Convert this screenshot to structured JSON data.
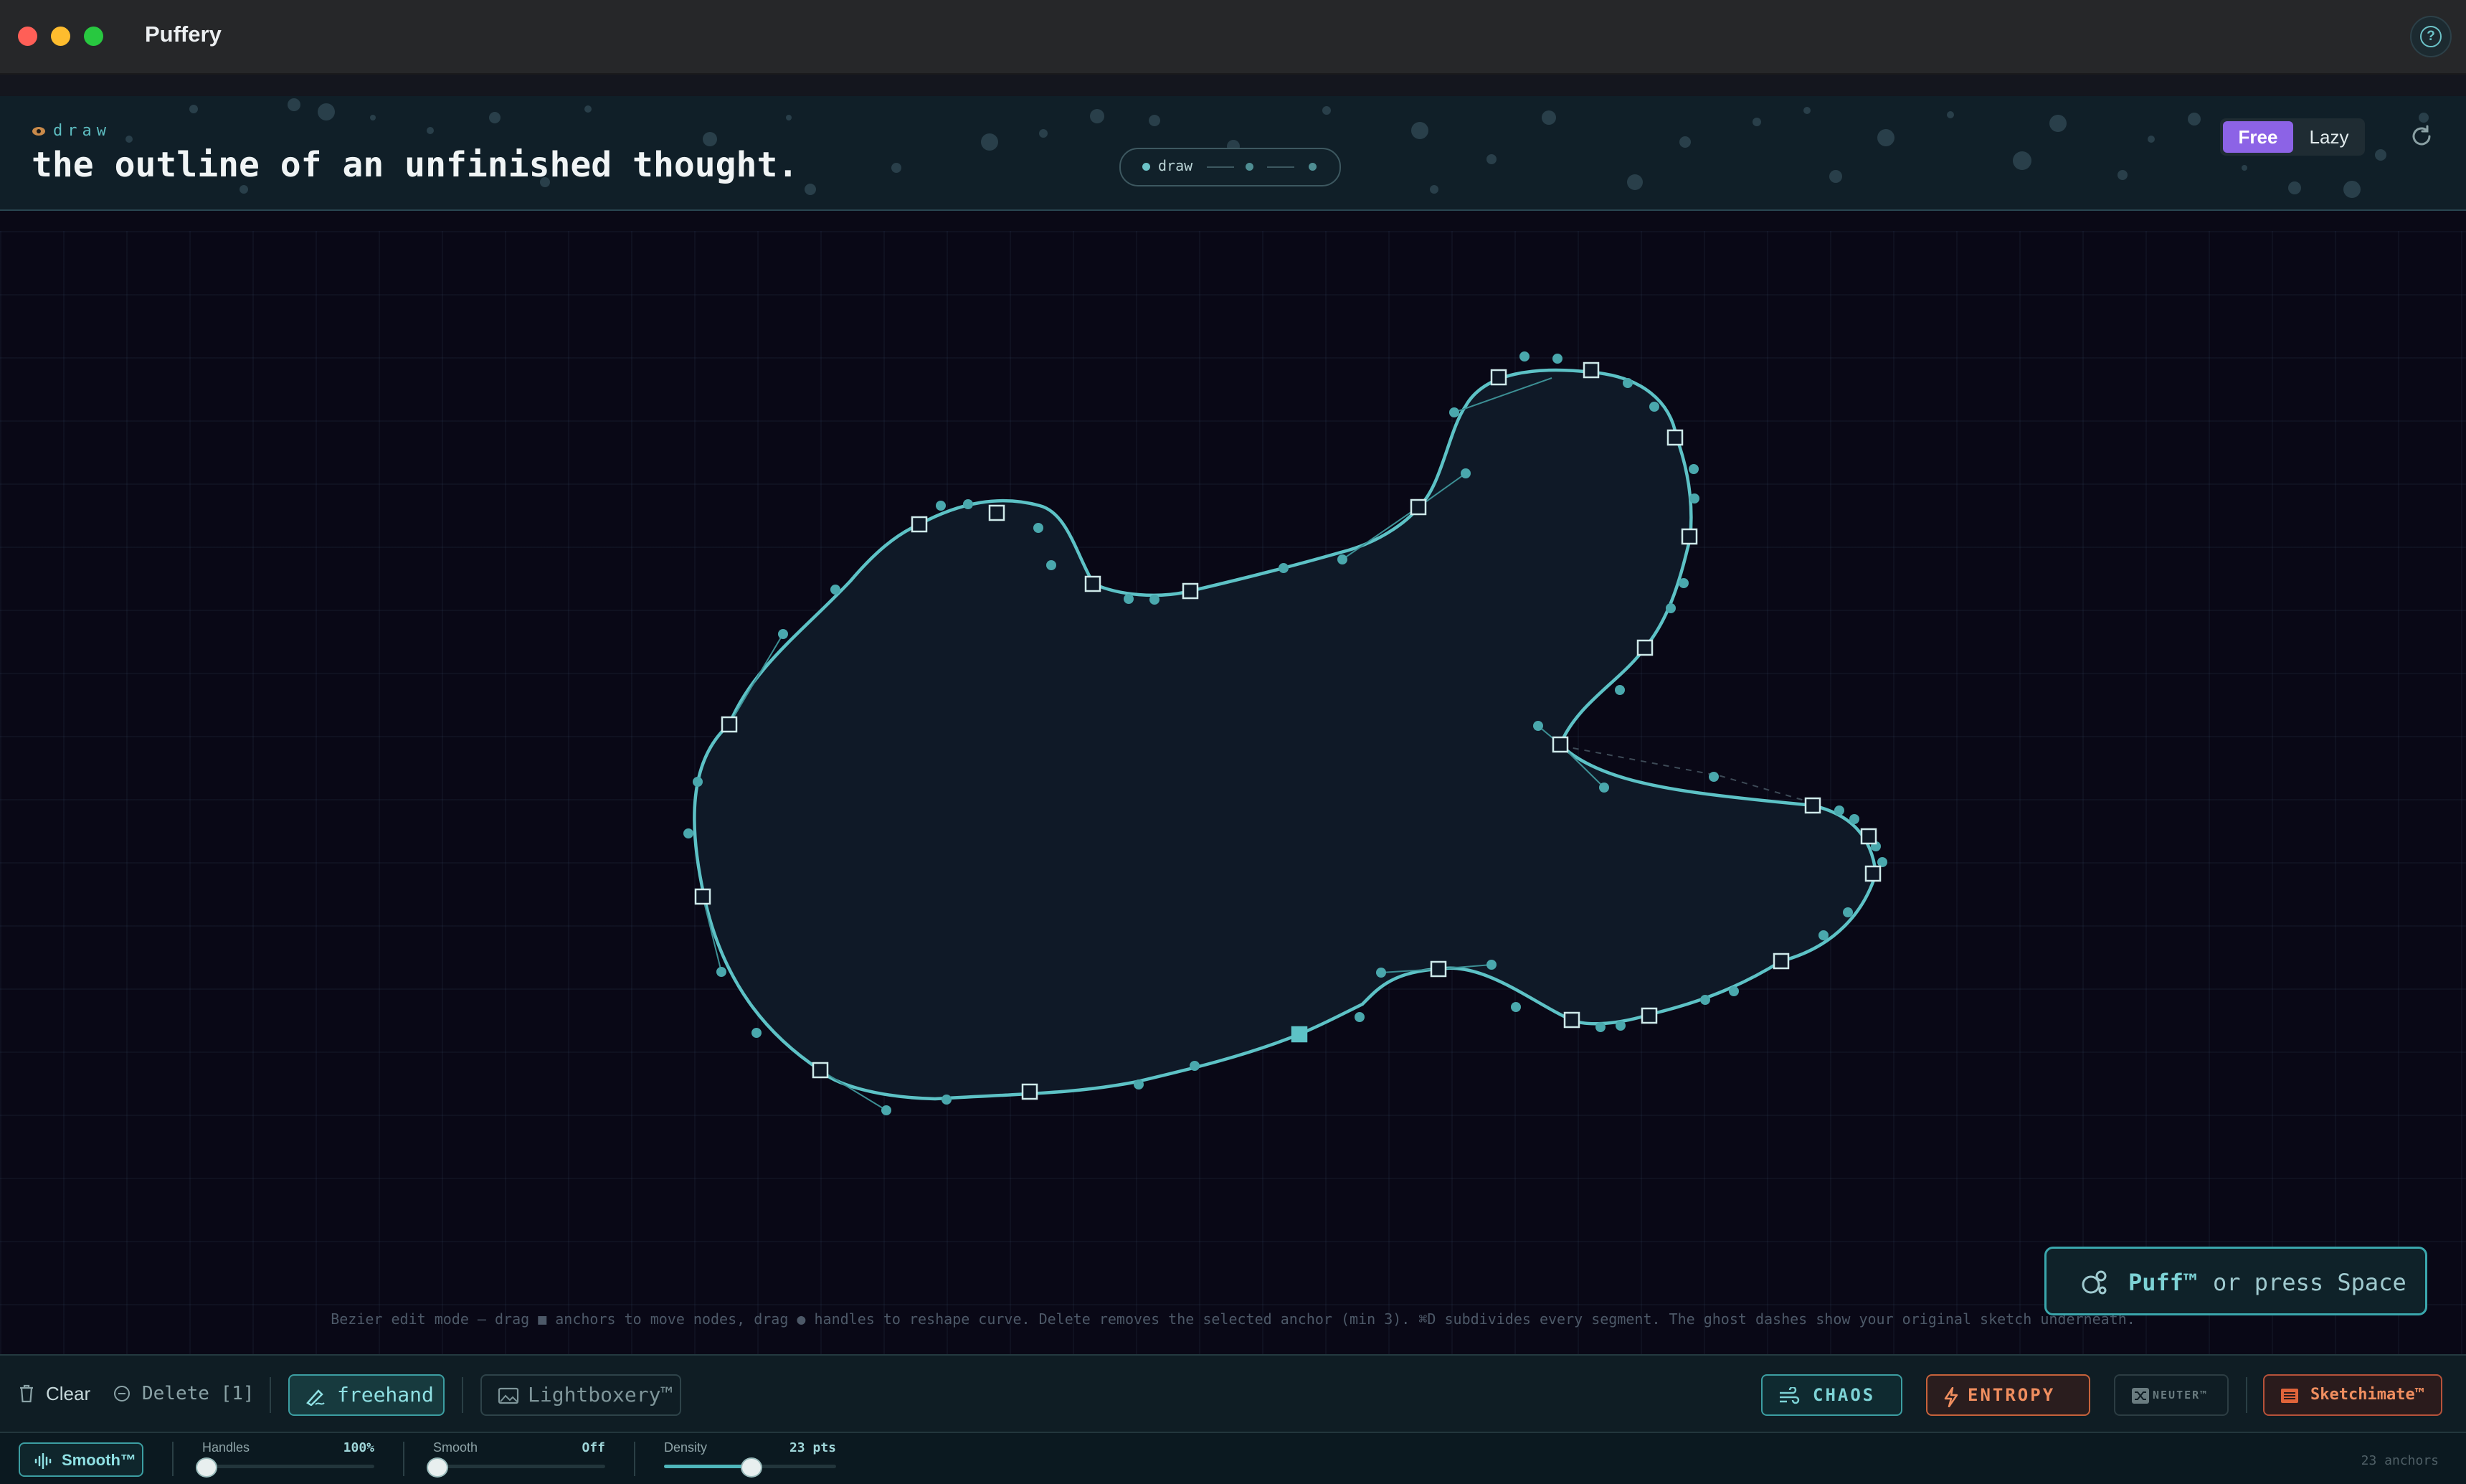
{
  "window": {
    "title": "Puffery"
  },
  "header": {
    "mode_tag": "draw",
    "headline": "the outline of an unfinished thought.",
    "stepper": {
      "current": "draw"
    },
    "segmented": {
      "options": [
        "Free",
        "Lazy"
      ],
      "selected": "Free"
    }
  },
  "canvas": {
    "hint": "Bezier edit mode — drag ■ anchors to move nodes, drag ● handles to reshape curve. Delete removes the selected anchor (min 3). ⌘D subdivides every segment. The ghost dashes show your original sketch underneath.",
    "puff": {
      "label": "Puff™",
      "rest": "or press Space"
    }
  },
  "toolbar": {
    "clear": "Clear",
    "delete": "Delete [1]",
    "freehand": "freehand",
    "lightboxery": "Lightboxery™",
    "chaos": "CHAOS",
    "entropy": "ENTROPY",
    "neuter": "NEUTER™",
    "sketchimate": "Sketchimate™"
  },
  "controls": {
    "smooth_toggle": "Smooth™",
    "handles": {
      "label": "Handles",
      "value_text": "100%",
      "fraction": 0.0
    },
    "smooth": {
      "label": "Smooth",
      "value_text": "Off",
      "fraction": 0.0
    },
    "density": {
      "label": "Density",
      "value_text": "23 pts",
      "fraction": 0.5
    },
    "anchor_count": "23 anchors"
  },
  "colors": {
    "accent": "#5dc2c6",
    "free_active": "#8c63e6",
    "entropy": "#f08e5f",
    "canvas_bg": "#090816"
  },
  "icons": [
    "help-icon",
    "eye-icon",
    "refresh-icon",
    "trash-icon",
    "minus-circle-icon",
    "pencil-icon",
    "image-icon",
    "wind-icon",
    "bolt-icon",
    "shuffle-icon",
    "film-icon",
    "waveform-icon",
    "bubbles-icon"
  ]
}
